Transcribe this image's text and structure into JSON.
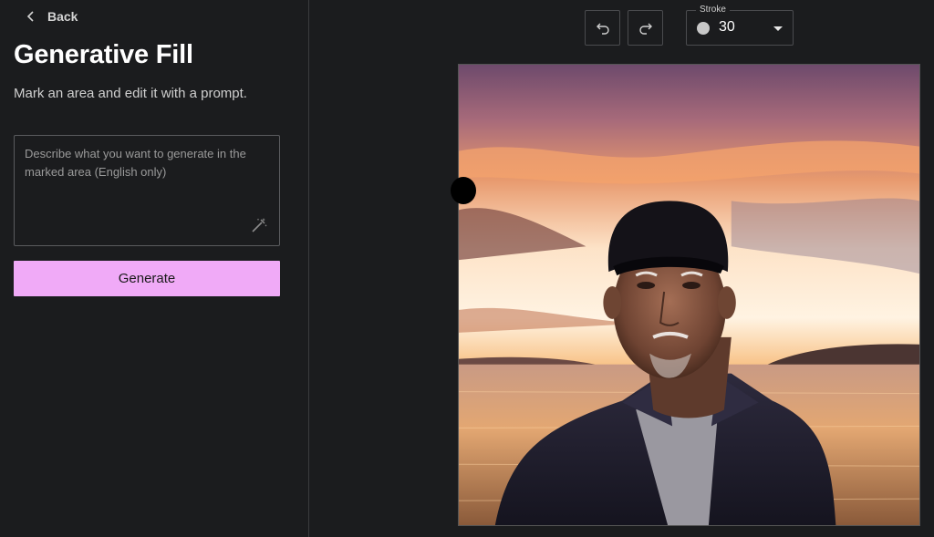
{
  "nav": {
    "back_label": "Back"
  },
  "panel": {
    "title": "Generative Fill",
    "subtitle": "Mark an area and edit it with a prompt.",
    "prompt_placeholder": "Describe what you want to generate in the marked area (English only)",
    "prompt_value": "",
    "generate_label": "Generate"
  },
  "toolbar": {
    "stroke_label": "Stroke",
    "stroke_value": "30"
  },
  "icons": {
    "back": "chevron-left-icon",
    "undo": "undo-icon",
    "redo": "redo-icon",
    "wand": "magic-wand-icon",
    "stroke_dot": "brush-size-dot",
    "caret": "caret-down-icon"
  },
  "colors": {
    "background": "#1b1c1e",
    "accent": "#f0aaf7",
    "border": "#4a4b4e"
  }
}
